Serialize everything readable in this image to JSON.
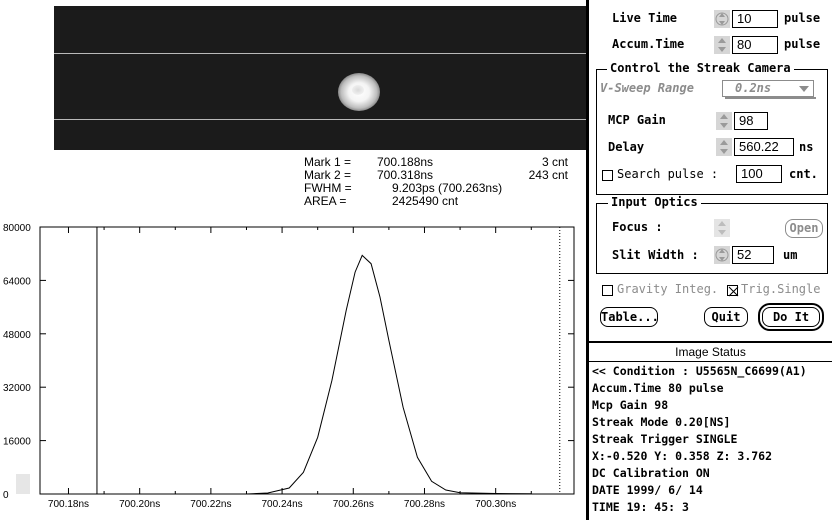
{
  "readout": {
    "mark1_label": "Mark 1 =",
    "mark1_time": "700.188ns",
    "mark1_count": "3 cnt",
    "mark2_label": "Mark 2 =",
    "mark2_time": "700.318ns",
    "mark2_count": "243 cnt",
    "fwhm_label": "FWHM =",
    "fwhm_value": "9.203ps (700.263ns)",
    "area_label": "AREA =",
    "area_value": "2425490 cnt"
  },
  "chart_data": {
    "type": "line",
    "title": "",
    "xlabel": "",
    "ylabel": "",
    "x_ticks": [
      "700.18ns",
      "700.20ns",
      "700.22ns",
      "700.24ns",
      "700.26ns",
      "700.28ns",
      "700.30ns"
    ],
    "x_tick_values": [
      700.18,
      700.2,
      700.22,
      700.24,
      700.26,
      700.28,
      700.3
    ],
    "y_ticks": [
      "0",
      "16000",
      "32000",
      "48000",
      "64000",
      "80000"
    ],
    "y_tick_values": [
      0,
      16000,
      32000,
      48000,
      64000,
      80000
    ],
    "xlim": [
      700.172,
      700.322
    ],
    "ylim": [
      0,
      80000
    ],
    "grid": false,
    "markers": [
      700.188,
      700.318
    ],
    "x": [
      700.18,
      700.23,
      700.236,
      700.242,
      700.246,
      700.25,
      700.254,
      700.258,
      700.2605,
      700.2625,
      700.265,
      700.2675,
      700.27,
      700.274,
      700.278,
      700.282,
      700.286,
      700.29,
      700.3,
      700.31
    ],
    "values": [
      0,
      0,
      300,
      1800,
      6500,
      17000,
      34000,
      55000,
      66500,
      71500,
      69000,
      59000,
      46000,
      26000,
      11000,
      3800,
      1200,
      400,
      150,
      50
    ]
  },
  "panel": {
    "live_time_label": "Live Time",
    "live_time_value": "10",
    "live_time_unit": "pulse",
    "accum_time_label": "Accum.Time",
    "accum_time_value": "80",
    "accum_time_unit": "pulse",
    "streak_group_title": "Control the Streak Camera",
    "vsweep_label": "V-Sweep Range",
    "vsweep_value": "0.2ns",
    "mcp_gain_label": "MCP Gain",
    "mcp_gain_value": "98",
    "delay_label": "Delay",
    "delay_value": "560.22",
    "delay_unit": "ns",
    "search_pulse_label": "Search pulse :",
    "search_pulse_value": "100",
    "search_pulse_unit": "cnt.",
    "optics_group_title": "Input Optics",
    "focus_label": "Focus :",
    "open_label": "Open",
    "slit_label": "Slit Width :",
    "slit_value": "52",
    "slit_unit": "um",
    "gravity_label": "Gravity Integ.",
    "trig_label": "Trig.Single",
    "table_label": "Table...",
    "quit_label": "Quit",
    "doit_label": "Do It"
  },
  "status": {
    "title": "Image Status",
    "lines": [
      "<< Condition : U5565N_C6699(A1)",
      "Accum.Time  80 pulse",
      "Mcp Gain  98",
      "Streak Mode  0.20[NS]",
      "Streak Trigger SINGLE",
      "X:-0.520 Y: 0.358 Z: 3.762",
      "DC Calibration ON",
      "DATE  1999/ 6/ 14",
      "TIME  19: 45: 3"
    ]
  }
}
